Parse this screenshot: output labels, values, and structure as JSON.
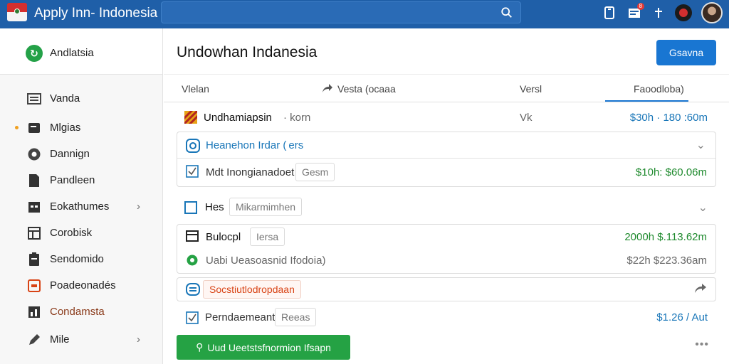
{
  "app": {
    "title": "Apply Inn- Indonesia"
  },
  "topbar": {
    "search_placeholder": "",
    "icons": [
      "search-icon",
      "tablet-icon",
      "notification-icon",
      "pin-icon",
      "record-icon",
      "avatar"
    ],
    "notification_badge": "8"
  },
  "sidebar": {
    "header": "Andlatsia",
    "items": [
      {
        "label": "Vanda",
        "icon": "inbox-icon",
        "has_chevron": false,
        "active_dot": false
      },
      {
        "label": "Mlgias",
        "icon": "folder-icon",
        "has_chevron": false,
        "active_dot": true
      },
      {
        "label": "Dannign",
        "icon": "compass-icon",
        "has_chevron": false,
        "active_dot": false
      },
      {
        "label": "Pandleen",
        "icon": "document-icon",
        "has_chevron": false,
        "active_dot": false
      },
      {
        "label": "Eokathumes",
        "icon": "calendar-icon",
        "has_chevron": true,
        "active_dot": false
      },
      {
        "label": "Corobisk",
        "icon": "grid-icon",
        "has_chevron": false,
        "active_dot": false
      },
      {
        "label": "Sendomido",
        "icon": "clipboard-icon",
        "has_chevron": false,
        "active_dot": false
      },
      {
        "label": "Poadeonadés",
        "icon": "card-icon",
        "has_chevron": false,
        "active_dot": false
      },
      {
        "label": "Condamsta",
        "icon": "chart-icon",
        "has_chevron": false,
        "active_dot": false
      },
      {
        "label": "Mile",
        "icon": "pen-icon",
        "has_chevron": true,
        "active_dot": false
      }
    ]
  },
  "main": {
    "title": "Undowhan Indanesia",
    "primary_button": "Gsavna",
    "columns": {
      "c1": "Vlelan",
      "c2": "Vesta (ocaaa",
      "c3": "Versl",
      "c4": "Faoodloba)"
    },
    "rows": [
      {
        "label": "Undhamiapsin",
        "sub": "· korn",
        "col": "Vk",
        "amount": "$30h · 180 :60m"
      },
      {
        "label": "Heanehon Irdar ( ers",
        "sub": "",
        "col": "",
        "amount": ""
      },
      {
        "label": "Mdt Inongianadoet",
        "sub": "Gesm",
        "col": "",
        "amount": "$10h: $60.06m"
      },
      {
        "label": "Hes",
        "sub": "Mikarmimhen",
        "col": "",
        "amount": ""
      },
      {
        "label": "Bulocpl",
        "sub": "Iersa",
        "col": "",
        "amount": "2000h $.113.62m"
      },
      {
        "label": "Uabi Ueasoasnid Ifodoia)",
        "sub": "",
        "col": "",
        "amount": "$22h $223.36am"
      },
      {
        "label": "Socstiutlodropdaan",
        "sub": "",
        "col": "",
        "amount": ""
      },
      {
        "label": "Perndaemeant",
        "sub": "Reeas",
        "col": "",
        "amount": "$1.26 / Aut"
      }
    ],
    "cta_button": "Uud Ueetstsfnormion Ifsapn",
    "more": "•••"
  },
  "colors": {
    "topbar": "#1f5fa8",
    "accent": "#1976d2",
    "success": "#25a244",
    "amount_green": "#1f8a2e",
    "amount_blue": "#1976b8"
  }
}
